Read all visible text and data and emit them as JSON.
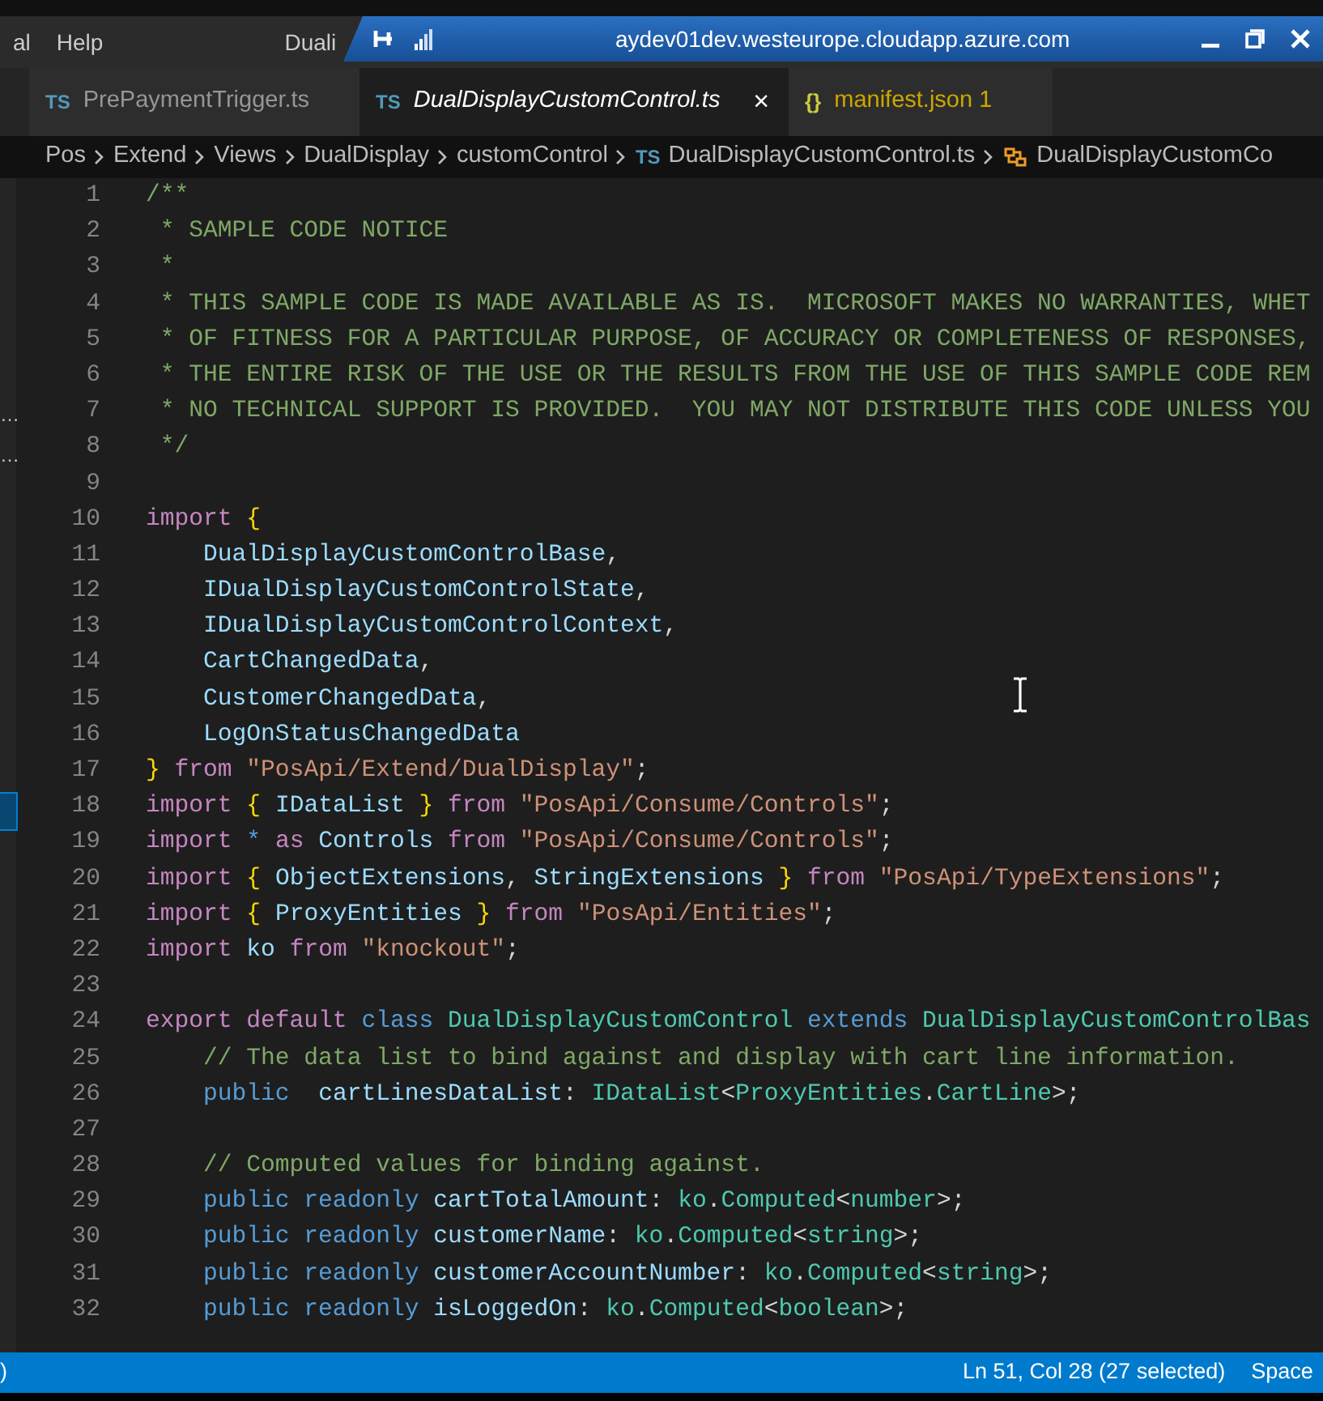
{
  "menu": [
    {
      "label": "al"
    },
    {
      "label": "Help"
    }
  ],
  "window_title": "Duali",
  "remote_bar": {
    "title": "aydev01dev.westeurope.cloudapp.azure.com"
  },
  "tabs": [
    {
      "icon": "TS",
      "label": "PrePaymentTrigger.ts",
      "selected": false,
      "warning": false
    },
    {
      "icon": "TS",
      "label": "DualDisplayCustomControl.ts",
      "selected": true,
      "warning": false,
      "close": "×"
    },
    {
      "icon": "{}",
      "label": "manifest.json",
      "count": "1",
      "selected": false,
      "warning": true
    }
  ],
  "breadcrumb": [
    {
      "kind": "folder",
      "text": "Pos"
    },
    {
      "kind": "folder",
      "text": "Extend"
    },
    {
      "kind": "folder",
      "text": "Views"
    },
    {
      "kind": "folder",
      "text": "DualDisplay"
    },
    {
      "kind": "folder",
      "text": "customControl"
    },
    {
      "kind": "file",
      "icon": "TS",
      "text": "DualDisplayCustomControl.ts"
    },
    {
      "kind": "symbol",
      "text": "DualDisplayCustomCo"
    }
  ],
  "sidebar": {
    "items": [
      {
        "text": "…",
        "selected": false
      },
      {
        "text": "…",
        "selected": false
      },
      {
        "selected": true
      }
    ]
  },
  "editor": {
    "lines": [
      {
        "number": "1",
        "tokens": [
          {
            "kind": "comment",
            "text": "/**"
          }
        ]
      },
      {
        "number": "2",
        "tokens": [
          {
            "kind": "comment",
            "text": " * SAMPLE CODE NOTICE"
          }
        ]
      },
      {
        "number": "3",
        "tokens": [
          {
            "kind": "comment",
            "text": " *"
          }
        ]
      },
      {
        "number": "4",
        "tokens": [
          {
            "kind": "comment",
            "text": " * THIS SAMPLE CODE IS MADE AVAILABLE AS IS.  MICROSOFT MAKES NO WARRANTIES, WHET"
          }
        ]
      },
      {
        "number": "5",
        "tokens": [
          {
            "kind": "comment",
            "text": " * OF FITNESS FOR A PARTICULAR PURPOSE, OF ACCURACY OR COMPLETENESS OF RESPONSES,"
          }
        ]
      },
      {
        "number": "6",
        "tokens": [
          {
            "kind": "comment",
            "text": " * THE ENTIRE RISK OF THE USE OR THE RESULTS FROM THE USE OF THIS SAMPLE CODE REM"
          }
        ]
      },
      {
        "number": "7",
        "tokens": [
          {
            "kind": "comment",
            "text": " * NO TECHNICAL SUPPORT IS PROVIDED.  YOU MAY NOT DISTRIBUTE THIS CODE UNLESS YOU"
          }
        ]
      },
      {
        "number": "8",
        "tokens": [
          {
            "kind": "comment",
            "text": " */"
          }
        ]
      },
      {
        "number": "9"
      },
      {
        "number": "10",
        "tokens": [
          {
            "kind": "keyword",
            "text": "import "
          },
          {
            "kind": "bracket",
            "text": "{"
          }
        ]
      },
      {
        "number": "11",
        "tokens": [
          {
            "kind": "variable",
            "text": "    DualDisplayCustomControlBase"
          },
          {
            "kind": "punctuation",
            "text": ","
          }
        ]
      },
      {
        "number": "12",
        "tokens": [
          {
            "kind": "variable",
            "text": "    IDualDisplayCustomControlState"
          },
          {
            "kind": "punctuation",
            "text": ","
          }
        ]
      },
      {
        "number": "13",
        "tokens": [
          {
            "kind": "variable",
            "text": "    IDualDisplayCustomControlContext"
          },
          {
            "kind": "punctuation",
            "text": ","
          }
        ]
      },
      {
        "number": "14",
        "tokens": [
          {
            "kind": "variable",
            "text": "    CartChangedData"
          },
          {
            "kind": "punctuation",
            "text": ","
          }
        ]
      },
      {
        "number": "15",
        "tokens": [
          {
            "kind": "variable",
            "text": "    CustomerChangedData"
          },
          {
            "kind": "punctuation",
            "text": ","
          }
        ]
      },
      {
        "number": "16",
        "tokens": [
          {
            "kind": "variable",
            "text": "    LogOnStatusChangedData"
          }
        ]
      },
      {
        "number": "17",
        "tokens": [
          {
            "kind": "bracket",
            "text": "}"
          },
          {
            "kind": "keyword",
            "text": " from "
          },
          {
            "kind": "string",
            "text": "\"PosApi/Extend/DualDisplay\""
          },
          {
            "kind": "punctuation",
            "text": ";"
          }
        ]
      },
      {
        "number": "18",
        "tokens": [
          {
            "kind": "keyword",
            "text": "import "
          },
          {
            "kind": "bracket",
            "text": "{"
          },
          {
            "kind": "variable",
            "text": " IDataList "
          },
          {
            "kind": "bracket",
            "text": "}"
          },
          {
            "kind": "keyword",
            "text": " from "
          },
          {
            "kind": "string",
            "text": "\"PosApi/Consume/Controls\""
          },
          {
            "kind": "punctuation",
            "text": ";"
          }
        ]
      },
      {
        "number": "19",
        "tokens": [
          {
            "kind": "keyword",
            "text": "import "
          },
          {
            "kind": "storage",
            "text": "* "
          },
          {
            "kind": "keyword",
            "text": "as "
          },
          {
            "kind": "variable",
            "text": "Controls "
          },
          {
            "kind": "keyword",
            "text": "from "
          },
          {
            "kind": "string",
            "text": "\"PosApi/Consume/Controls\""
          },
          {
            "kind": "punctuation",
            "text": ";"
          }
        ]
      },
      {
        "number": "20",
        "tokens": [
          {
            "kind": "keyword",
            "text": "import "
          },
          {
            "kind": "bracket",
            "text": "{"
          },
          {
            "kind": "variable",
            "text": " ObjectExtensions"
          },
          {
            "kind": "punctuation",
            "text": ","
          },
          {
            "kind": "variable",
            "text": " StringExtensions "
          },
          {
            "kind": "bracket",
            "text": "}"
          },
          {
            "kind": "keyword",
            "text": " from "
          },
          {
            "kind": "string",
            "text": "\"PosApi/TypeExtensions\""
          },
          {
            "kind": "punctuation",
            "text": ";"
          }
        ]
      },
      {
        "number": "21",
        "tokens": [
          {
            "kind": "keyword",
            "text": "import "
          },
          {
            "kind": "bracket",
            "text": "{"
          },
          {
            "kind": "variable",
            "text": " ProxyEntities "
          },
          {
            "kind": "bracket",
            "text": "}"
          },
          {
            "kind": "keyword",
            "text": " from "
          },
          {
            "kind": "string",
            "text": "\"PosApi/Entities\""
          },
          {
            "kind": "punctuation",
            "text": ";"
          }
        ]
      },
      {
        "number": "22",
        "tokens": [
          {
            "kind": "keyword",
            "text": "import "
          },
          {
            "kind": "variable",
            "text": "ko "
          },
          {
            "kind": "keyword",
            "text": "from "
          },
          {
            "kind": "string",
            "text": "\"knockout\""
          },
          {
            "kind": "punctuation",
            "text": ";"
          }
        ]
      },
      {
        "number": "23"
      },
      {
        "number": "24",
        "tokens": [
          {
            "kind": "keyword",
            "text": "export default "
          },
          {
            "kind": "storage",
            "text": "class "
          },
          {
            "kind": "type",
            "text": "DualDisplayCustomControl "
          },
          {
            "kind": "storage",
            "text": "extends "
          },
          {
            "kind": "type",
            "text": "DualDisplayCustomControlBas"
          }
        ]
      },
      {
        "number": "25",
        "tokens": [
          {
            "kind": "comment",
            "text": "    // The data list to bind against and display with cart line information."
          }
        ]
      },
      {
        "number": "26",
        "tokens": [
          {
            "kind": "storage",
            "text": "    public  "
          },
          {
            "kind": "variable",
            "text": "cartLinesDataList"
          },
          {
            "kind": "punctuation",
            "text": ": "
          },
          {
            "kind": "type",
            "text": "IDataList"
          },
          {
            "kind": "punctuation",
            "text": "<"
          },
          {
            "kind": "type",
            "text": "ProxyEntities"
          },
          {
            "kind": "punctuation",
            "text": "."
          },
          {
            "kind": "type",
            "text": "CartLine"
          },
          {
            "kind": "punctuation",
            "text": ">;"
          }
        ]
      },
      {
        "number": "27"
      },
      {
        "number": "28",
        "tokens": [
          {
            "kind": "comment",
            "text": "    // Computed values for binding against."
          }
        ]
      },
      {
        "number": "29",
        "tokens": [
          {
            "kind": "storage",
            "text": "    public readonly "
          },
          {
            "kind": "variable",
            "text": "cartTotalAmount"
          },
          {
            "kind": "punctuation",
            "text": ": "
          },
          {
            "kind": "type",
            "text": "ko"
          },
          {
            "kind": "punctuation",
            "text": "."
          },
          {
            "kind": "type",
            "text": "Computed"
          },
          {
            "kind": "punctuation",
            "text": "<"
          },
          {
            "kind": "type",
            "text": "number"
          },
          {
            "kind": "punctuation",
            "text": ">;"
          }
        ]
      },
      {
        "number": "30",
        "tokens": [
          {
            "kind": "storage",
            "text": "    public readonly "
          },
          {
            "kind": "variable",
            "text": "customerName"
          },
          {
            "kind": "punctuation",
            "text": ": "
          },
          {
            "kind": "type",
            "text": "ko"
          },
          {
            "kind": "punctuation",
            "text": "."
          },
          {
            "kind": "type",
            "text": "Computed"
          },
          {
            "kind": "punctuation",
            "text": "<"
          },
          {
            "kind": "type",
            "text": "string"
          },
          {
            "kind": "punctuation",
            "text": ">;"
          }
        ]
      },
      {
        "number": "31",
        "tokens": [
          {
            "kind": "storage",
            "text": "    public readonly "
          },
          {
            "kind": "variable",
            "text": "customerAccountNumber"
          },
          {
            "kind": "punctuation",
            "text": ": "
          },
          {
            "kind": "type",
            "text": "ko"
          },
          {
            "kind": "punctuation",
            "text": "."
          },
          {
            "kind": "type",
            "text": "Computed"
          },
          {
            "kind": "punctuation",
            "text": "<"
          },
          {
            "kind": "type",
            "text": "string"
          },
          {
            "kind": "punctuation",
            "text": ">;"
          }
        ]
      },
      {
        "number": "32",
        "tokens": [
          {
            "kind": "storage",
            "text": "    public readonly "
          },
          {
            "kind": "variable",
            "text": "isLoggedOn"
          },
          {
            "kind": "punctuation",
            "text": ": "
          },
          {
            "kind": "type",
            "text": "ko"
          },
          {
            "kind": "punctuation",
            "text": "."
          },
          {
            "kind": "type",
            "text": "Computed"
          },
          {
            "kind": "punctuation",
            "text": "<"
          },
          {
            "kind": "type",
            "text": "boolean"
          },
          {
            "kind": "punctuation",
            "text": ">;"
          }
        ]
      }
    ]
  },
  "status_bar": {
    "left": ")",
    "items": [
      "Ln 51, Col 28 (27 selected)",
      "Space"
    ]
  }
}
